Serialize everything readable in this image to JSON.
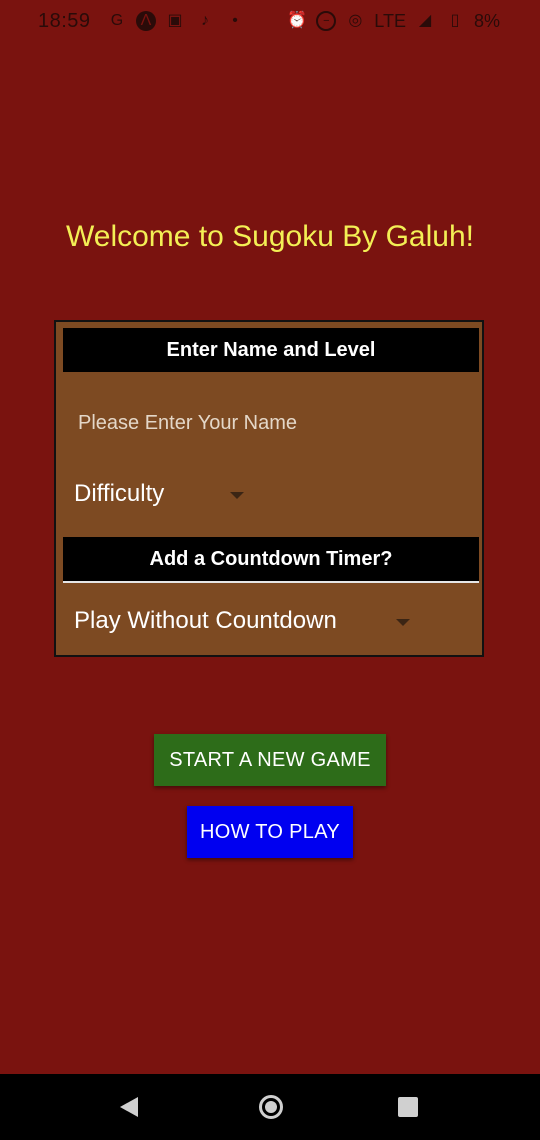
{
  "status_bar": {
    "time": "18:59",
    "left_icons": [
      "google-icon",
      "arc-icon",
      "gallery-icon",
      "tiktok-icon",
      "dot-icon"
    ],
    "right_icons": [
      "alarm-icon",
      "dnd-icon",
      "hotspot-icon",
      "lte-signal-icon",
      "battery-icon"
    ],
    "network": "LTE",
    "battery": "8%"
  },
  "welcome_text": "Welcome to Sugoku By Galuh!",
  "panel": {
    "header_name_level": "Enter Name and Level",
    "name_placeholder": "Please Enter Your Name",
    "difficulty_value": "Difficulty",
    "header_timer": "Add a Countdown Timer?",
    "timer_value": "Play Without Countdown"
  },
  "buttons": {
    "start": "START A NEW GAME",
    "how_to_play": "HOW TO PLAY"
  },
  "colors": {
    "background": "#7a130f",
    "welcome_text": "#f3ef55",
    "panel": "#7d4a22",
    "start_button": "#2d6c19",
    "how_button": "#0000f0"
  }
}
